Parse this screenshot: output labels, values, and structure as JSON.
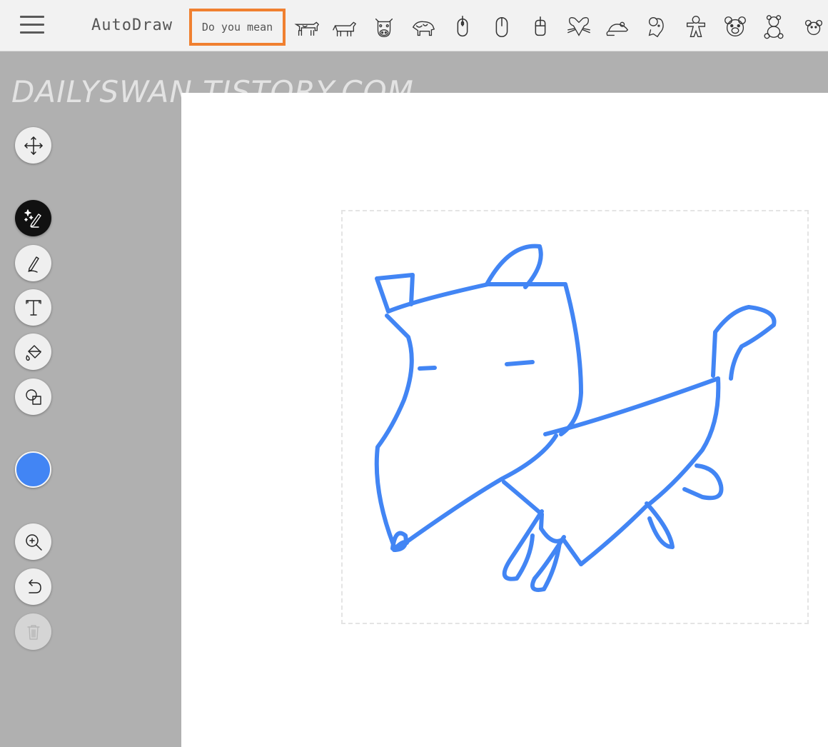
{
  "app": {
    "title": "AutoDraw"
  },
  "suggestions": {
    "label": "Do you mean",
    "items": [
      {
        "icon": "cow-icon"
      },
      {
        "icon": "cow-side-icon"
      },
      {
        "icon": "cow-face-icon"
      },
      {
        "icon": "animal-icon"
      },
      {
        "icon": "computer-mouse-icon"
      },
      {
        "icon": "computer-mouse-2-icon"
      },
      {
        "icon": "computer-mouse-3-icon"
      },
      {
        "icon": "mouse-face-icon"
      },
      {
        "icon": "mouse-animal-icon"
      },
      {
        "icon": "mouse-head-icon"
      },
      {
        "icon": "gingerbread-icon"
      },
      {
        "icon": "bear-face-icon"
      },
      {
        "icon": "teddy-bear-icon"
      },
      {
        "icon": "bear-head-icon"
      }
    ]
  },
  "watermark": "DAILYSWAN.TISTORY.COM",
  "toolbar": {
    "tools": [
      {
        "name": "move",
        "icon": "move-icon"
      },
      {
        "name": "autodraw",
        "icon": "autodraw-icon",
        "active": true
      },
      {
        "name": "draw",
        "icon": "pencil-icon"
      },
      {
        "name": "text",
        "icon": "text-icon"
      },
      {
        "name": "fill",
        "icon": "fill-bucket-icon"
      },
      {
        "name": "shape",
        "icon": "shapes-icon"
      },
      {
        "name": "zoom",
        "icon": "zoom-icon"
      },
      {
        "name": "undo",
        "icon": "undo-icon"
      },
      {
        "name": "delete",
        "icon": "trash-icon",
        "disabled": true
      }
    ],
    "color": "#4285f4"
  },
  "colors": {
    "stroke": "#4285f4",
    "highlight": "#f08030",
    "sidebar": "#b0b0b0",
    "topbar": "#f2f2f2"
  }
}
